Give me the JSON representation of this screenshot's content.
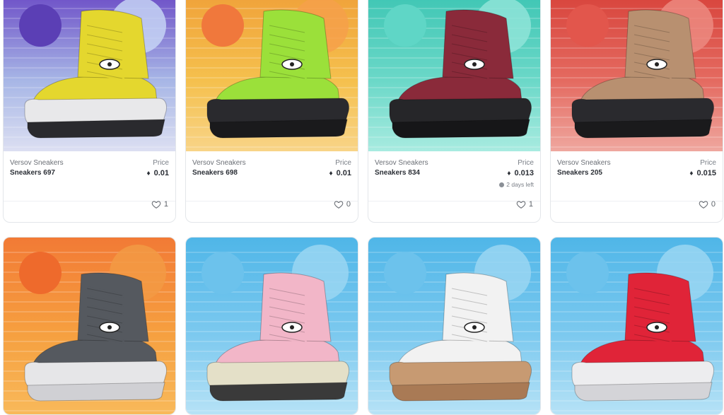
{
  "cards": [
    {
      "collection": "Versov Sneakers",
      "name": "Sneakers 697",
      "price_label": "Price",
      "price": "0.01",
      "time_left": "",
      "likes": "1",
      "colors": {
        "bg_top": "#6d4fc7",
        "bg_mid": "#a7b6e6",
        "bg_bottom": "#dcdff2",
        "sun": "#5b3fb5",
        "sun2": "#c6d4f4",
        "shoe": "#e4d72e",
        "sole": "#e8e8ea",
        "tread": "#2a2a2e"
      }
    },
    {
      "collection": "Versov Sneakers",
      "name": "Sneakers 698",
      "price_label": "Price",
      "price": "0.01",
      "time_left": "",
      "likes": "0",
      "colors": {
        "bg_top": "#f0a23a",
        "bg_mid": "#f5c04d",
        "bg_bottom": "#f8d488",
        "sun": "#f0783c",
        "sun2": "#f6a04a",
        "shoe": "#9be03a",
        "sole": "#2a2a2e",
        "tread": "#1a1a1c"
      }
    },
    {
      "collection": "Versov Sneakers",
      "name": "Sneakers 834",
      "price_label": "Price",
      "price": "0.013",
      "time_left": "2 days left",
      "likes": "1",
      "colors": {
        "bg_top": "#3fc6b4",
        "bg_mid": "#6bd8c8",
        "bg_bottom": "#a8ebe0",
        "sun": "#5fd6c6",
        "sun2": "#8fe4d8",
        "shoe": "#8a2a3a",
        "sole": "#262629",
        "tread": "#161618"
      }
    },
    {
      "collection": "Versov Sneakers",
      "name": "Sneakers 205",
      "price_label": "Price",
      "price": "0.015",
      "time_left": "",
      "likes": "0",
      "colors": {
        "bg_top": "#d8443c",
        "bg_mid": "#e46a60",
        "bg_bottom": "#efa79f",
        "sun": "#e2564c",
        "sun2": "#ec8a80",
        "shoe": "#b89070",
        "sole": "#2a2a2e",
        "tread": "#1a1a1c"
      }
    },
    {
      "collection": "",
      "name": "",
      "price_label": "",
      "price": "",
      "time_left": "",
      "likes": "",
      "colors": {
        "bg_top": "#f27a35",
        "bg_mid": "#f6a040",
        "bg_bottom": "#f8b95a",
        "sun": "#ee6a2c",
        "sun2": "#f29a44",
        "shoe": "#55595f",
        "sole": "#e6e6e8",
        "tread": "#d0d0d4"
      }
    },
    {
      "collection": "",
      "name": "",
      "price_label": "",
      "price": "",
      "time_left": "",
      "likes": "",
      "colors": {
        "bg_top": "#4fb6e8",
        "bg_mid": "#7cc9ef",
        "bg_bottom": "#b6e2f6",
        "sun": "#6cc2ec",
        "sun2": "#9ad6f2",
        "shoe": "#f2b6c8",
        "sole": "#e4e0c8",
        "tread": "#3a3a3a"
      }
    },
    {
      "collection": "",
      "name": "",
      "price_label": "",
      "price": "",
      "time_left": "",
      "likes": "",
      "colors": {
        "bg_top": "#4fb6e8",
        "bg_mid": "#7cc9ef",
        "bg_bottom": "#b6e2f6",
        "sun": "#6cc2ec",
        "sun2": "#9ad6f2",
        "shoe": "#f2f2f2",
        "sole": "#c79a72",
        "tread": "#a97a55"
      }
    },
    {
      "collection": "",
      "name": "",
      "price_label": "",
      "price": "",
      "time_left": "",
      "likes": "",
      "colors": {
        "bg_top": "#4fb6e8",
        "bg_mid": "#7cc9ef",
        "bg_bottom": "#b6e2f6",
        "sun": "#6cc2ec",
        "sun2": "#9ad6f2",
        "shoe": "#e02438",
        "sole": "#ededef",
        "tread": "#d4d4d8"
      }
    }
  ],
  "icons": {
    "currency": "ethereum-icon",
    "like": "heart-outline-icon",
    "clock": "clock-icon"
  }
}
